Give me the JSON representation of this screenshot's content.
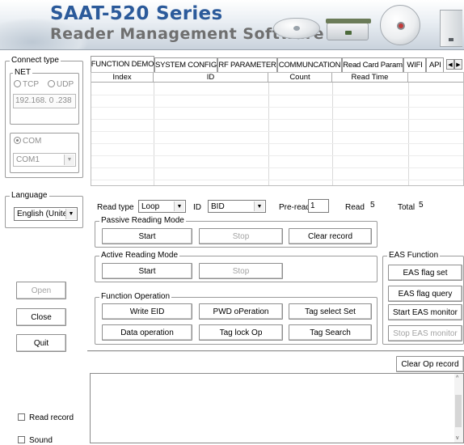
{
  "banner": {
    "title": "SAAT-520 Series",
    "subtitle": "Reader Management Software"
  },
  "connect": {
    "group_label": "Connect type",
    "net_label": "NET",
    "tcp_label": "TCP",
    "udp_label": "UDP",
    "ip_value": "192.168.  0  .238",
    "com_label": "COM",
    "com_port": "COM1"
  },
  "language": {
    "group_label": "Language",
    "value": "English (United"
  },
  "side_buttons": {
    "open": "Open",
    "close": "Close",
    "quit": "Quit"
  },
  "side_checks": {
    "read_record": "Read record",
    "sound": "Sound"
  },
  "tabs": [
    {
      "label": "FUNCTION DEMO"
    },
    {
      "label": "SYSTEM CONFIG"
    },
    {
      "label": "RF PARAMETER"
    },
    {
      "label": "COMMUNCATION"
    },
    {
      "label": "Read Card Param"
    },
    {
      "label": "WIFI"
    },
    {
      "label": "API"
    }
  ],
  "grid": {
    "columns": [
      "Index",
      "ID",
      "Count",
      "Read Time",
      ""
    ]
  },
  "read_params": {
    "read_type_label": "Read type",
    "read_type_value": "Loop",
    "id_label": "ID",
    "id_value": "BID",
    "pre_read_label": "Pre-read",
    "pre_read_value": "1",
    "read_label": "Read",
    "read_value": "5",
    "total_label": "Total",
    "total_value": "5"
  },
  "passive": {
    "label": "Passive Reading Mode",
    "start": "Start",
    "stop": "Stop",
    "clear": "Clear record"
  },
  "active": {
    "label": "Active Reading Mode",
    "start": "Start",
    "stop": "Stop"
  },
  "function_op": {
    "label": "Function Operation",
    "write_eid": "Write EID",
    "pwd_op": "PWD oPeration",
    "tag_select": "Tag select Set",
    "data_op": "Data operation",
    "tag_lock": "Tag lock Op",
    "tag_search": "Tag Search"
  },
  "eas": {
    "label": "EAS Function",
    "flag_set": "EAS flag set",
    "flag_query": "EAS flag query",
    "start_monitor": "Start EAS monitor",
    "stop_monitor": "Stop EAS monitor"
  },
  "output": {
    "clear_op": "Clear Op record"
  }
}
